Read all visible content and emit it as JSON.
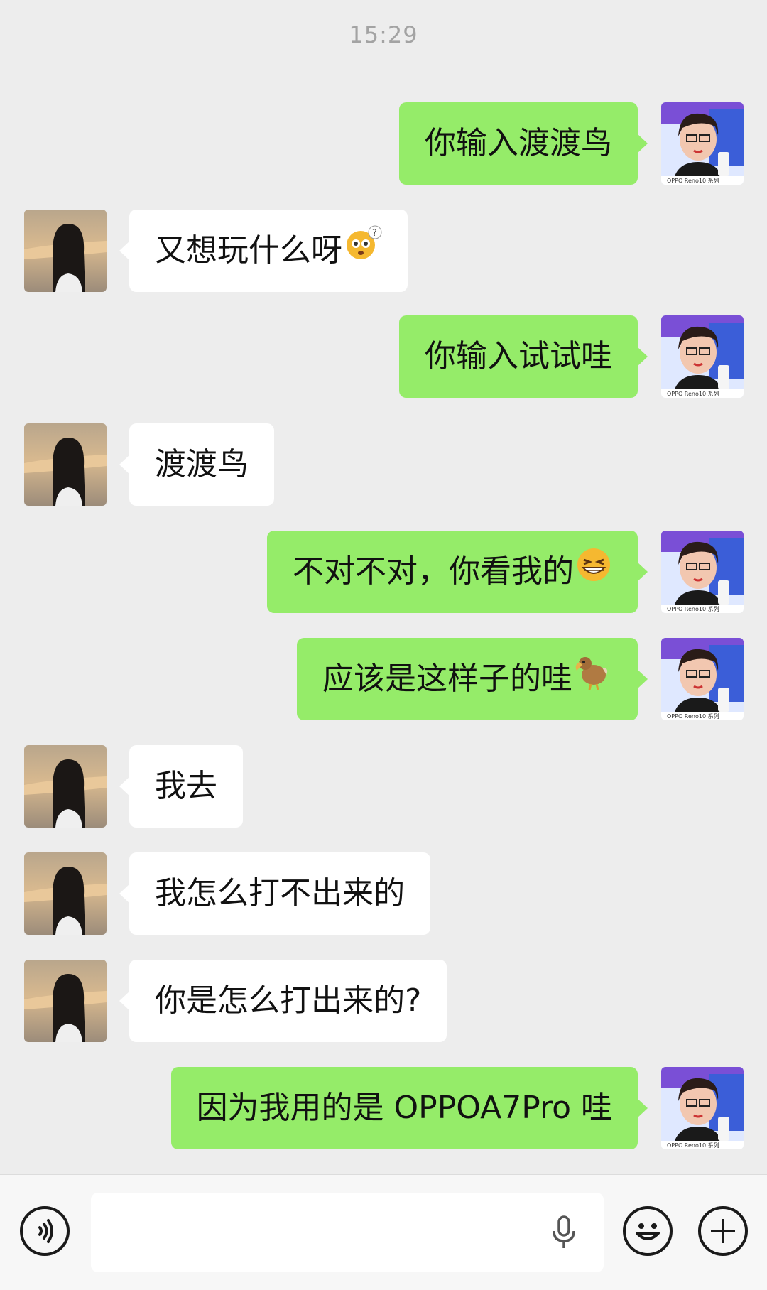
{
  "status": {
    "time": "15:29"
  },
  "messages": [
    {
      "side": "out",
      "text": "你输入渡渡鸟",
      "emoji": ""
    },
    {
      "side": "in",
      "text": "又想玩什么呀",
      "emoji": "flushed-face-question-emoji"
    },
    {
      "side": "out",
      "text": "你输入试试哇",
      "emoji": ""
    },
    {
      "side": "in",
      "text": "渡渡鸟",
      "emoji": ""
    },
    {
      "side": "out",
      "text": "不对不对，你看我的",
      "emoji": "grinning-squinting-face-emoji"
    },
    {
      "side": "out",
      "text": "应该是这样子的哇",
      "emoji": "dodo-emoji"
    },
    {
      "side": "in",
      "text": "我去",
      "emoji": ""
    },
    {
      "side": "in",
      "text": "我怎么打不出来的",
      "emoji": ""
    },
    {
      "side": "in",
      "text": "你是怎么打出来的?",
      "emoji": ""
    },
    {
      "side": "out",
      "text": "因为我用的是 OPPOA7Pro 哇",
      "emoji": ""
    }
  ],
  "avatars": {
    "self_banner_text": "OPPO Reno10 系列"
  },
  "input": {
    "placeholder": "",
    "voice_icon": "voice-input-icon",
    "mic_icon": "microphone-icon",
    "emoji_icon": "emoji-smile-icon",
    "plus_icon": "plus-more-icon"
  },
  "colors": {
    "background": "#ededed",
    "outgoing_bubble": "#95ec69",
    "incoming_bubble": "#ffffff",
    "time_text": "#a3a3a3"
  }
}
